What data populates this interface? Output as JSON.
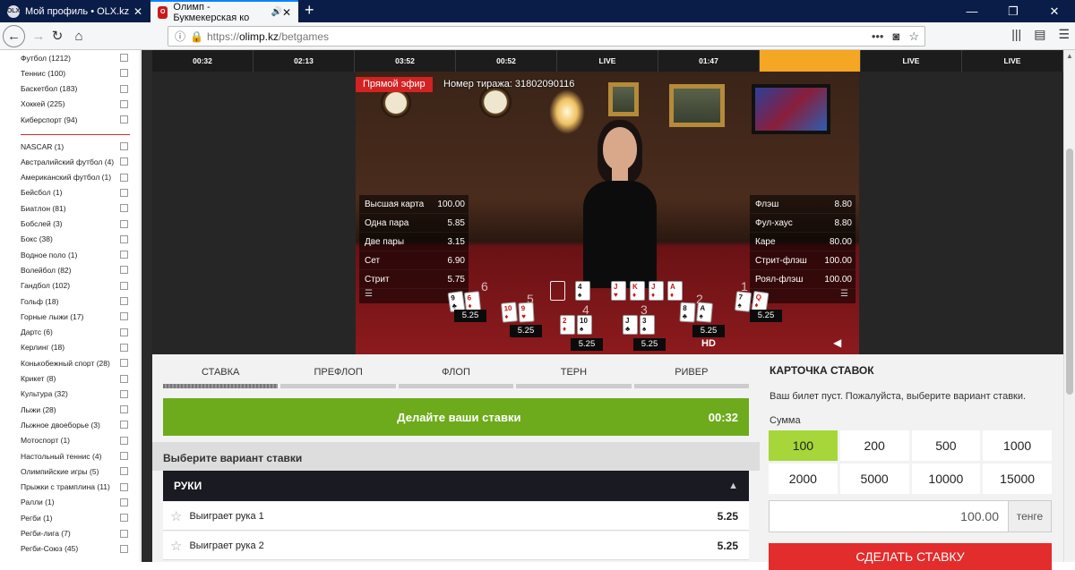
{
  "browser": {
    "tabs": [
      {
        "title": "Мой профиль • OLX.kz",
        "favicon": "OLX"
      },
      {
        "title": "Олимп - Букмекерская ко",
        "favicon": "O"
      }
    ],
    "url": {
      "protocol": "https://",
      "host": "olimp.kz",
      "path": "/betgames"
    }
  },
  "sidebar": {
    "items_top": [
      "Футбол (1212)",
      "Теннис (100)",
      "Баскетбол (183)",
      "Хоккей (225)",
      "Киберспорт (94)"
    ],
    "items": [
      "NASCAR (1)",
      "Австралийский футбол (4)",
      "Американский футбол (1)",
      "Бейсбол (1)",
      "Биатлон (81)",
      "Бобслей (3)",
      "Бокс (38)",
      "Водное поло (1)",
      "Волейбол (82)",
      "Гандбол (102)",
      "Гольф (18)",
      "Горные лыжи (17)",
      "Дартс (6)",
      "Керлинг (18)",
      "Конькобежный спорт (28)",
      "Крикет (8)",
      "Культура (32)",
      "Лыжи (28)",
      "Лыжное двоеборье (3)",
      "Мотоспорт (1)",
      "Настольный теннис (4)",
      "Олимпийские игры (5)",
      "Прыжки с трамплина (11)",
      "Ралли (1)",
      "Регби (1)",
      "Регби-лига (7)",
      "Регби-Союз (45)"
    ]
  },
  "timer_bar": [
    "00:32",
    "02:13",
    "03:52",
    "00:52",
    "LIVE",
    "01:47",
    "",
    "LIVE",
    "LIVE"
  ],
  "video": {
    "live_badge": "Прямой эфир",
    "draw_number": "Номер тиража: 31802090116",
    "odds_left": [
      {
        "label": "Высшая карта",
        "value": "100.00"
      },
      {
        "label": "Одна пара",
        "value": "5.85"
      },
      {
        "label": "Две пары",
        "value": "3.15"
      },
      {
        "label": "Сет",
        "value": "6.90"
      },
      {
        "label": "Стрит",
        "value": "5.75"
      }
    ],
    "odds_right": [
      {
        "label": "Флэш",
        "value": "8.80"
      },
      {
        "label": "Фул-хаус",
        "value": "8.80"
      },
      {
        "label": "Каре",
        "value": "80.00"
      },
      {
        "label": "Стрит-флэш",
        "value": "100.00"
      },
      {
        "label": "Роял-флэш",
        "value": "100.00"
      }
    ],
    "hand_odds": [
      "5.25",
      "5.25",
      "5.25",
      "5.25",
      "5.25",
      "5.25"
    ],
    "hd_label": "HD",
    "icons": {
      "list": "list-icon",
      "volume": "volume-icon"
    }
  },
  "bet": {
    "stages": [
      "СТАВКА",
      "ПРЕФЛОП",
      "ФЛОП",
      "ТЕРН",
      "РИВЕР"
    ],
    "place_bets": "Делайте ваши ставки",
    "countdown": "00:32",
    "choose": "Выберите вариант ставки",
    "group": "РУКИ",
    "rows": [
      {
        "label": "Выиграет рука 1",
        "value": "5.25"
      },
      {
        "label": "Выиграет рука 2",
        "value": "5.25"
      }
    ]
  },
  "slip": {
    "title": "КАРТОЧКА СТАВОК",
    "empty": "Ваш билет пуст. Пожалуйста, выберите вариант ставки.",
    "sum_label": "Сумма",
    "amounts": [
      "100",
      "200",
      "500",
      "1000",
      "2000",
      "5000",
      "10000",
      "15000"
    ],
    "amount_value": "100.00",
    "currency": "тенге",
    "submit": "СДЕЛАТЬ СТАВКУ"
  },
  "colors": {
    "accent_green": "#6dab1c",
    "selected_amount": "#a6d63a",
    "submit_red": "#e32c2c",
    "active_timer": "#f5a623"
  }
}
